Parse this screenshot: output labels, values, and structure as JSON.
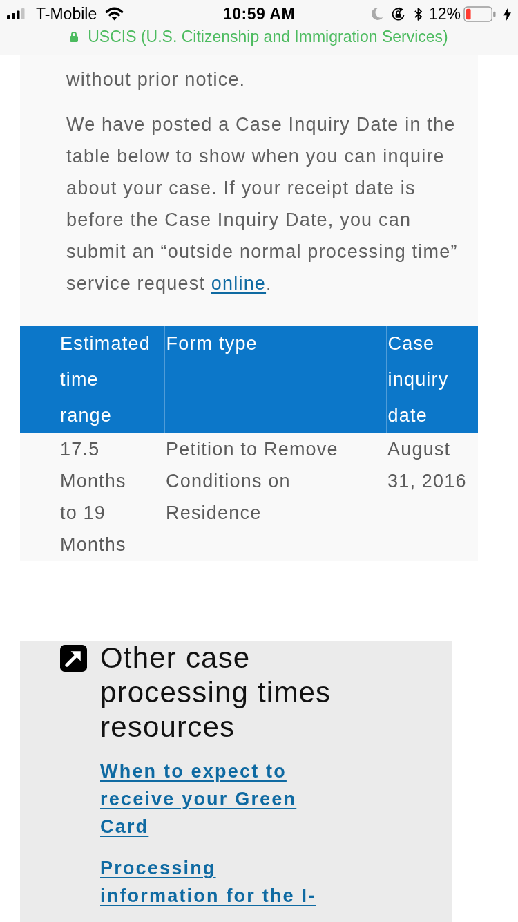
{
  "status_bar": {
    "carrier": "T-Mobile",
    "time": "10:59 AM",
    "battery_percent": "12%",
    "charging": true
  },
  "address_bar": {
    "secure": true,
    "site_name": "USCIS (U.S. Citizenship and Immigration Services)"
  },
  "notice": {
    "paragraphs": [
      {
        "text": "without prior notice."
      },
      {
        "text": "We have posted a Case Inquiry Date in the table below to show when you can inquire about your case. If your receipt date is before the Case Inquiry Date, you can submit an “outside normal processing time” service request ",
        "link": "online",
        "after": "."
      }
    ]
  },
  "table": {
    "columns": [
      "Estimated time range",
      "Form type",
      "Case inquiry date"
    ],
    "rows": [
      [
        "17.5 Months to 19 Months",
        "Petition to Remove Conditions on Residence",
        "August 31, 2016"
      ]
    ]
  },
  "resources": {
    "title": "Other case processing times resources",
    "links": [
      "When to expect to receive your Green Card",
      "Processing information for the I-"
    ]
  }
}
